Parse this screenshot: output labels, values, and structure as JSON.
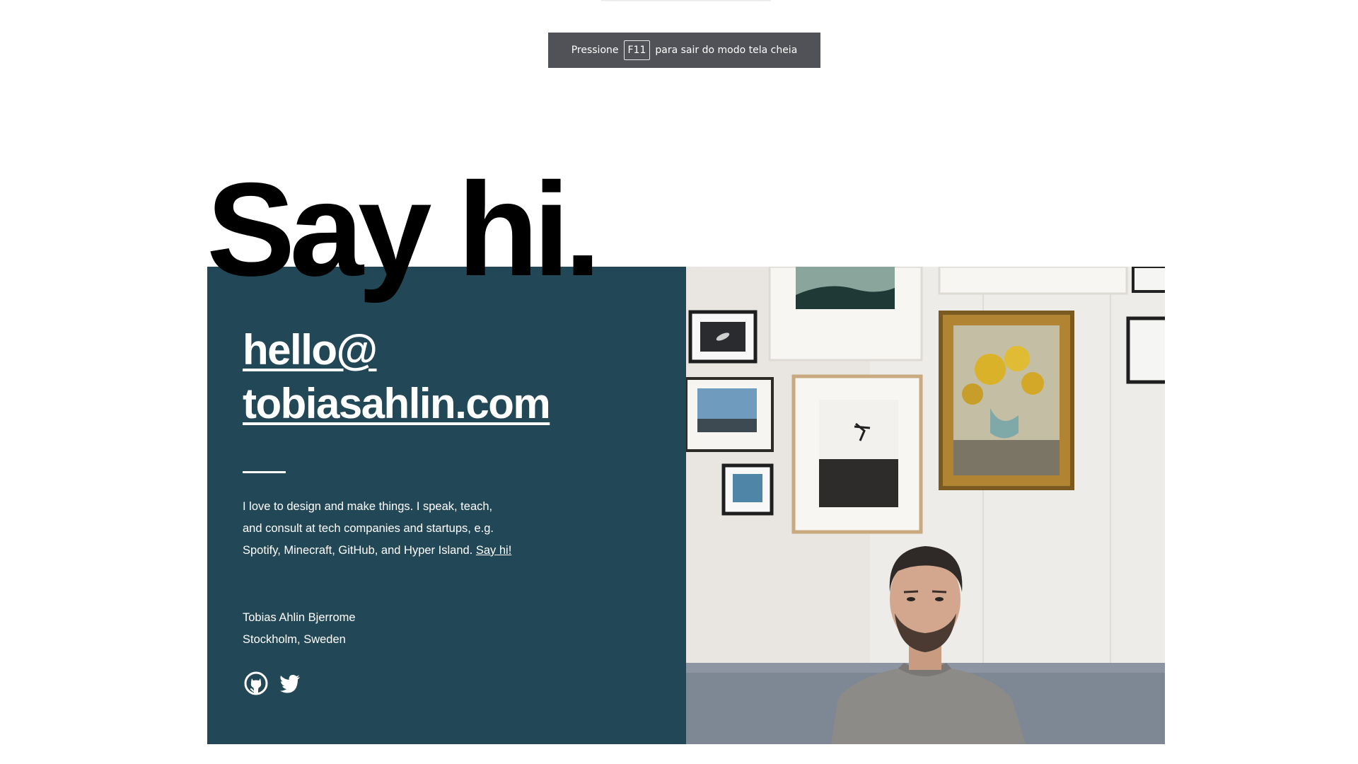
{
  "fullscreen_notice": {
    "prefix": "Pressione",
    "key": "F11",
    "suffix": "para sair do modo tela cheia"
  },
  "heading": "Say hi.",
  "contact": {
    "email_line1": "hello@",
    "email_line2": "tobiasahlin.com",
    "bio": "I love to design and make things. I speak, teach, and consult at tech companies and startups, e.g. Spotify, Minecraft, GitHub, and Hyper Island.",
    "bio_link": "Say hi!",
    "name": "Tobias Ahlin Bjerrome",
    "location": "Stockholm, Sweden",
    "social_icons": [
      "github-icon",
      "twitter-icon"
    ]
  },
  "colors": {
    "panel": "#224756",
    "notice": "#505257",
    "text_light": "#ffffff",
    "heading": "#000000"
  }
}
